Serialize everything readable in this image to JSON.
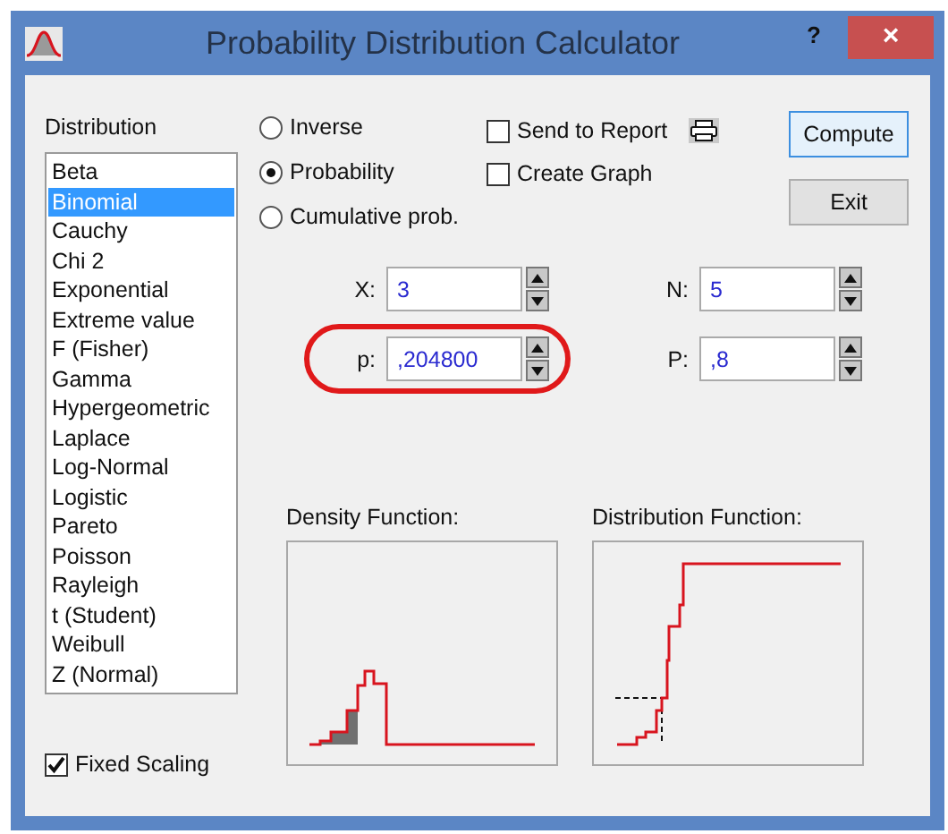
{
  "window": {
    "title": "Probability Distribution Calculator",
    "help": "?",
    "close": "×"
  },
  "distribution": {
    "label": "Distribution",
    "items": [
      {
        "label": "Beta",
        "selected": false
      },
      {
        "label": "Binomial",
        "selected": true
      },
      {
        "label": "Cauchy",
        "selected": false
      },
      {
        "label": "Chi 2",
        "selected": false
      },
      {
        "label": "Exponential",
        "selected": false
      },
      {
        "label": "Extreme value",
        "selected": false
      },
      {
        "label": "F (Fisher)",
        "selected": false
      },
      {
        "label": "Gamma",
        "selected": false
      },
      {
        "label": "Hypergeometric",
        "selected": false
      },
      {
        "label": "Laplace",
        "selected": false
      },
      {
        "label": "Log-Normal",
        "selected": false
      },
      {
        "label": "Logistic",
        "selected": false
      },
      {
        "label": "Pareto",
        "selected": false
      },
      {
        "label": "Poisson",
        "selected": false
      },
      {
        "label": "Rayleigh",
        "selected": false
      },
      {
        "label": "t (Student)",
        "selected": false
      },
      {
        "label": "Weibull",
        "selected": false
      },
      {
        "label": "Z (Normal)",
        "selected": false
      }
    ]
  },
  "modes": [
    {
      "label": "Inverse",
      "selected": false
    },
    {
      "label": "Probability",
      "selected": true
    },
    {
      "label": "Cumulative prob.",
      "selected": false
    }
  ],
  "options": [
    {
      "label": "Send to Report",
      "checked": false,
      "kind": "report"
    },
    {
      "label": "Create Graph",
      "checked": false,
      "kind": "plain"
    }
  ],
  "buttons": [
    {
      "label": "Compute",
      "default": true
    },
    {
      "label": "Exit",
      "default": false
    }
  ],
  "fields": [
    {
      "label": "X:",
      "value": "3",
      "highlighted": false
    },
    {
      "label": "N:",
      "value": "5",
      "highlighted": false
    },
    {
      "label": "p:",
      "value": ",204800",
      "highlighted": true
    },
    {
      "label": "P:",
      "value": ",8",
      "highlighted": false
    }
  ],
  "charts": [
    {
      "title": "Density Function:",
      "kind": "density"
    },
    {
      "title": "Distribution Function:",
      "kind": "distribution"
    }
  ],
  "fixed_scaling": {
    "label": "Fixed Scaling",
    "checked": true
  }
}
